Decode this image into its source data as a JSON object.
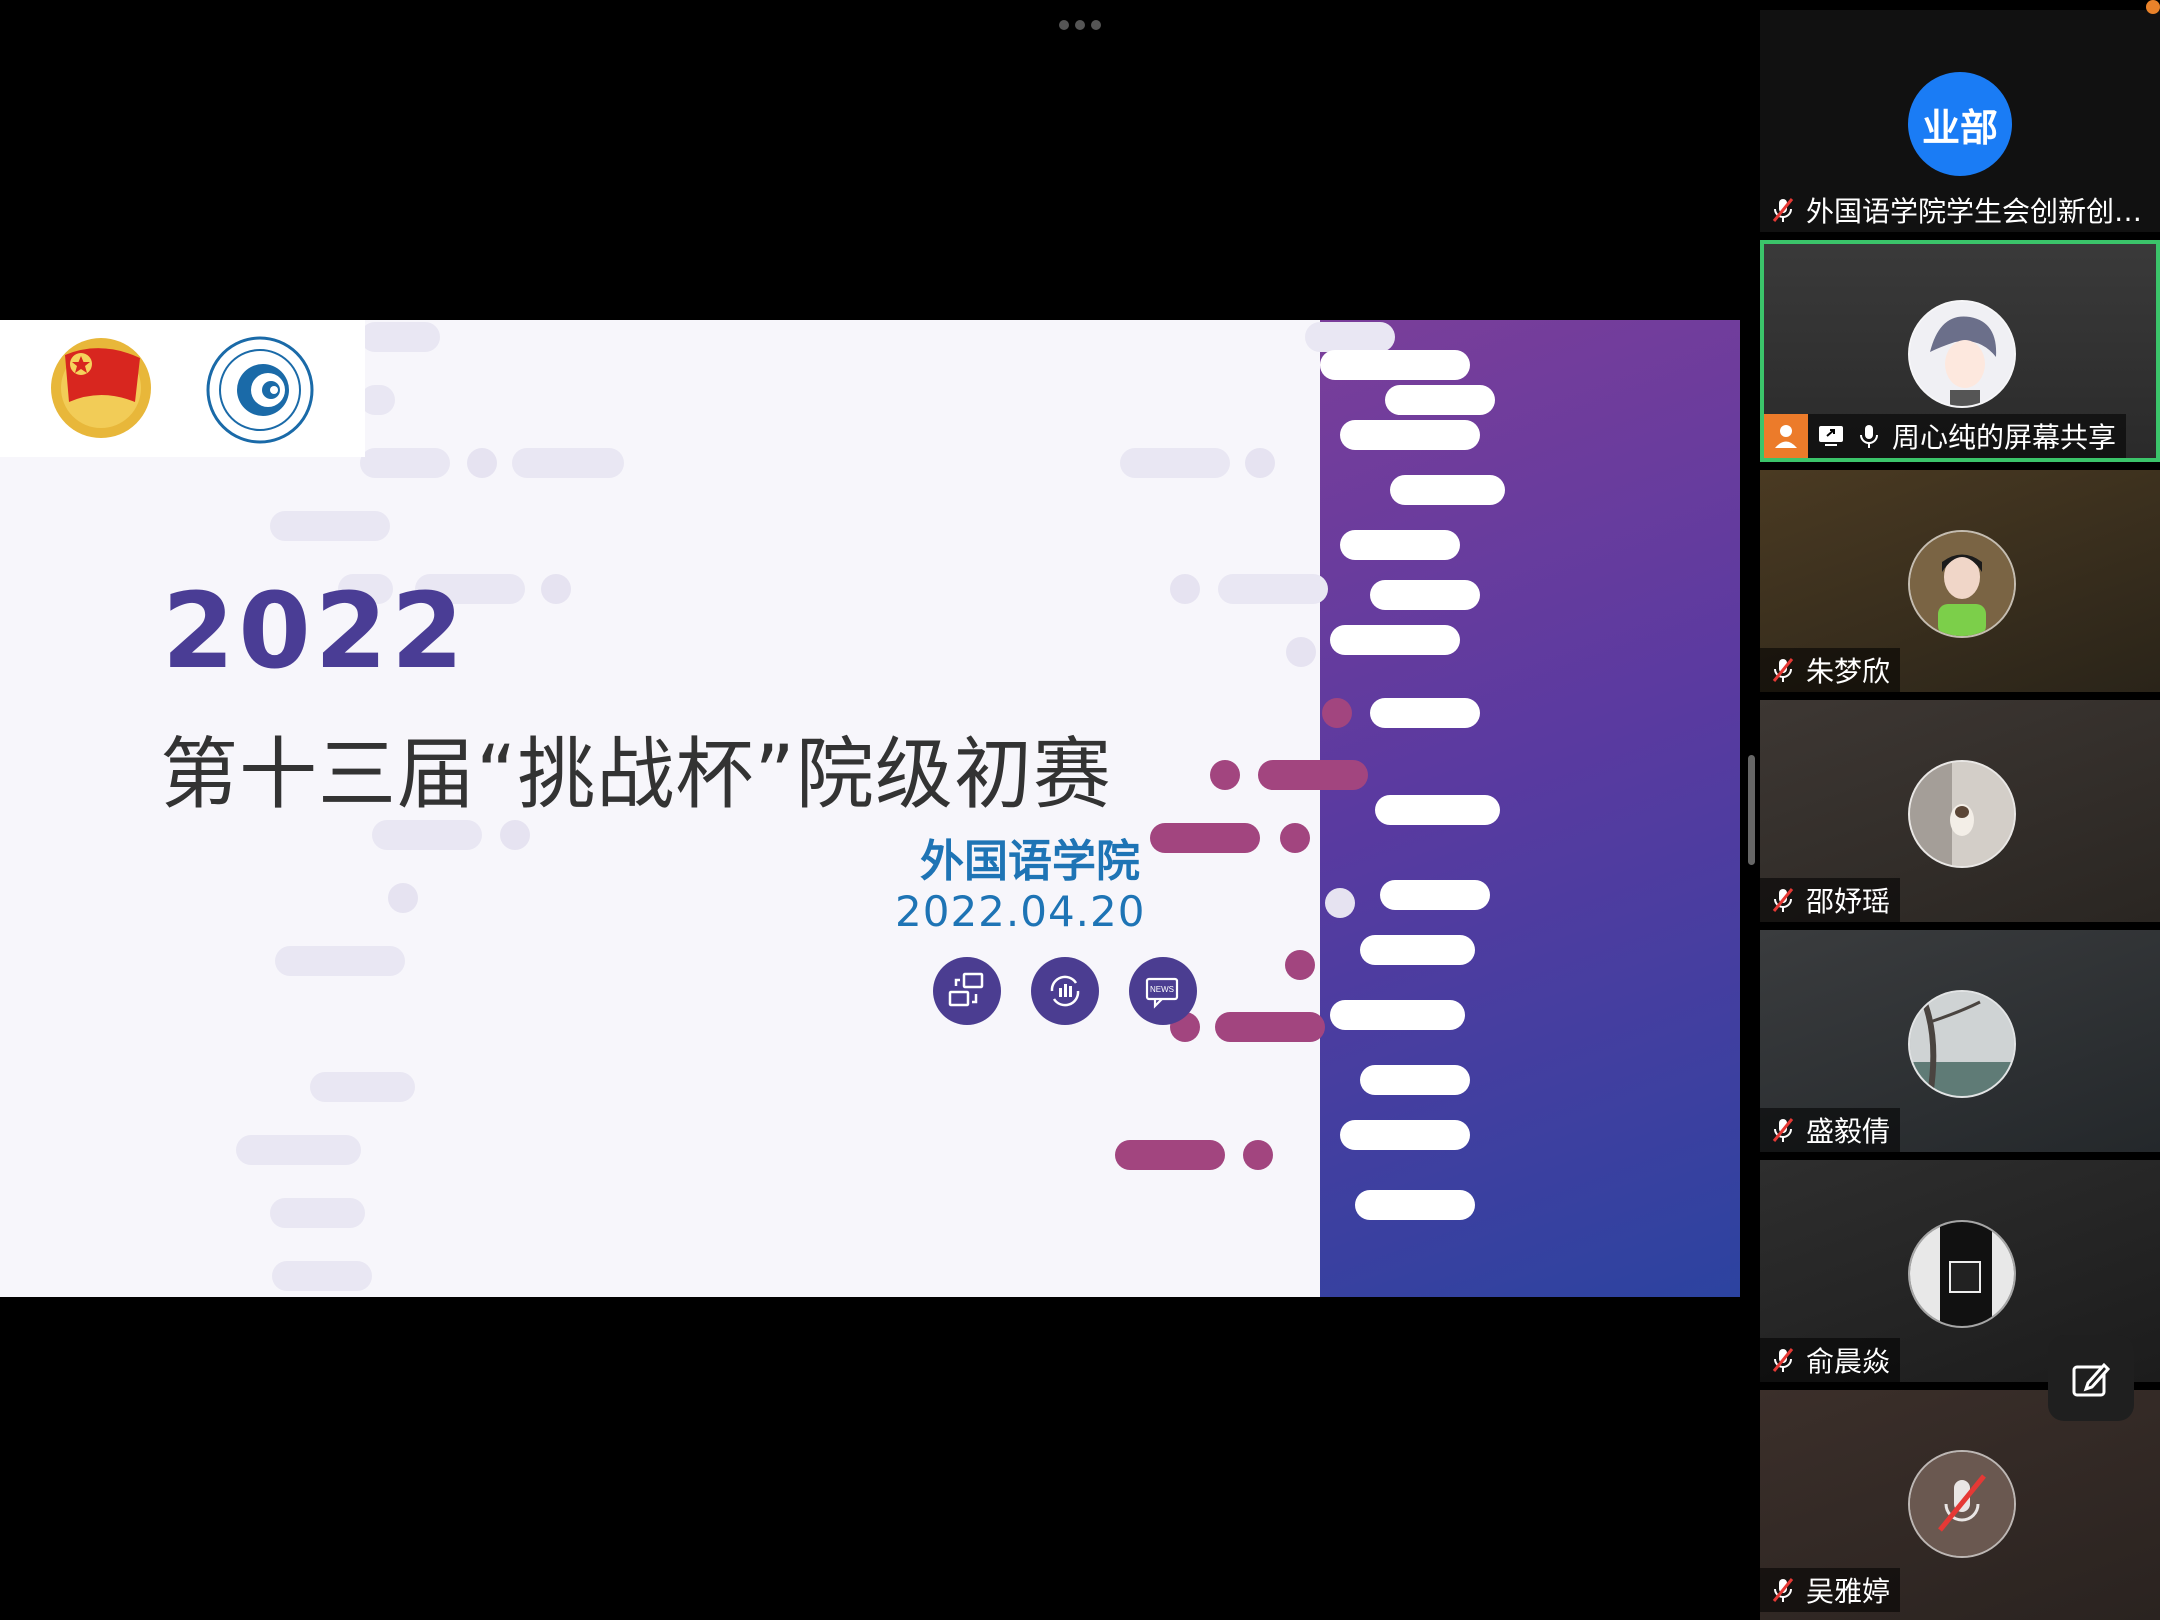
{
  "top_bar": {
    "more_icon": "ellipsis-icon"
  },
  "slide": {
    "year": "2022",
    "title": "第十三届“挑战杯”院级初赛",
    "college": "外国语学院",
    "date": "2022.04.20",
    "icons": [
      "share-screen-icon",
      "chart-refresh-icon",
      "news-icon"
    ],
    "emblem_text": "中国共青团",
    "university_seal": "长春理工大学 CHANGCHUN INSTITUTE OF TECHNOLOGY",
    "colors": {
      "year": "#4a3d95",
      "college": "#1e74b5",
      "accent": "#a2457f",
      "gradient_end": "#2c43a0"
    }
  },
  "participants": [
    {
      "name": "外国语学院学生会创新创…",
      "avatar_text": "业部",
      "avatar_color": "#1a7cf5",
      "muted": true
    },
    {
      "name": "周心纯的屏幕共享",
      "active": true,
      "muted": false,
      "sharing": true
    },
    {
      "name": "朱梦欣",
      "muted": true
    },
    {
      "name": "邵妤瑶",
      "muted": true
    },
    {
      "name": "盛毅倩",
      "muted": true
    },
    {
      "name": "俞晨焱",
      "muted": true
    },
    {
      "name": "吴雅婷",
      "muted": true
    }
  ],
  "floating": {
    "edit_icon": "annotate-icon"
  }
}
